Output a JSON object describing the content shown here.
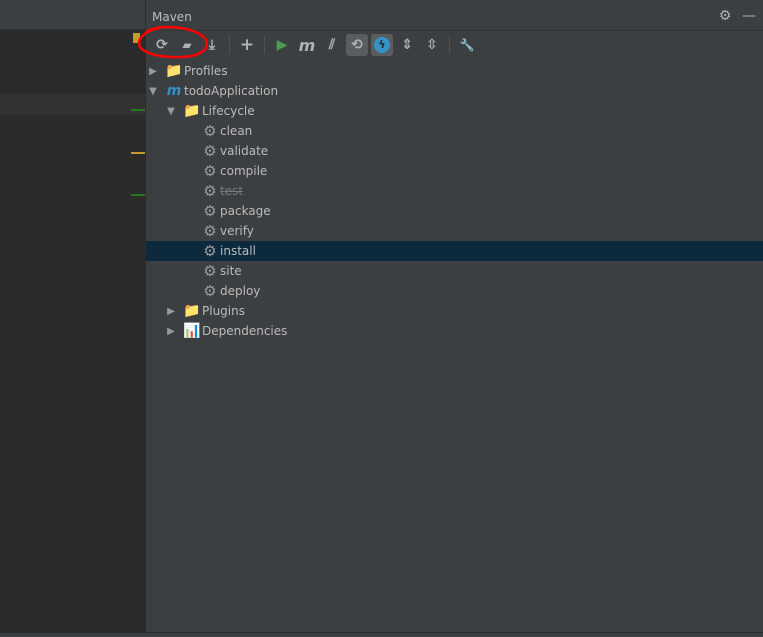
{
  "panel": {
    "title": "Maven"
  },
  "header_icons": [
    "gear-icon",
    "minimize-icon"
  ],
  "toolbar": [
    {
      "name": "reload-all-projects-button",
      "glyph": "⟳"
    },
    {
      "name": "generate-sources-button",
      "glyph": "▰"
    },
    {
      "name": "download-sources-button",
      "glyph": "⤓"
    },
    {
      "name": "add-maven-project-button",
      "glyph": "+"
    },
    {
      "name": "run-maven-build-button",
      "glyph": "▶"
    },
    {
      "name": "execute-maven-goal-button",
      "glyph": "m"
    },
    {
      "name": "toggle-offline-mode-button",
      "glyph": "⫽"
    },
    {
      "name": "toggle-skip-tests-button",
      "glyph": "⟲"
    },
    {
      "name": "show-dependencies-button",
      "glyph": "ϟ"
    },
    {
      "name": "expand-all-button",
      "glyph": "⇕"
    },
    {
      "name": "collapse-all-button",
      "glyph": "⇳"
    },
    {
      "name": "maven-settings-button",
      "glyph": "🔧"
    }
  ],
  "tree": {
    "profiles": "Profiles",
    "project": "todoApplication",
    "lifecycle": "Lifecycle",
    "goals": [
      "clean",
      "validate",
      "compile",
      "test",
      "package",
      "verify",
      "install",
      "site",
      "deploy"
    ],
    "plugins": "Plugins",
    "dependencies": "Dependencies",
    "selected_goal": "install",
    "disabled_goal": "test"
  },
  "colors": {
    "selection": "#0d293e",
    "annotation": "#ff0000",
    "run": "#499c54",
    "accent": "#3592c4"
  }
}
